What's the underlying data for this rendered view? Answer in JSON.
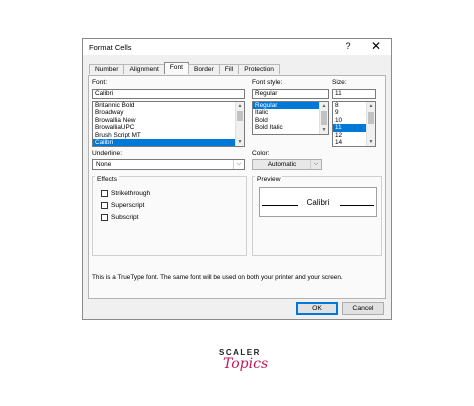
{
  "dialog": {
    "title": "Format Cells",
    "help": "?",
    "close": "✕"
  },
  "tabs": [
    {
      "label": "Number"
    },
    {
      "label": "Alignment"
    },
    {
      "label": "Font",
      "active": true
    },
    {
      "label": "Border"
    },
    {
      "label": "Fill"
    },
    {
      "label": "Protection"
    }
  ],
  "font": {
    "label": "Font:",
    "value": "Calibri",
    "items": [
      "Britannic Bold",
      "Broadway",
      "Browallia New",
      "BrowalliaUPC",
      "Brush Script MT",
      "Calibri"
    ],
    "selected": "Calibri"
  },
  "style": {
    "label": "Font style:",
    "value": "Regular",
    "items": [
      "Regular",
      "Italic",
      "Bold",
      "Bold Italic"
    ],
    "selected": "Regular"
  },
  "size": {
    "label": "Size:",
    "value": "11",
    "items": [
      "8",
      "9",
      "10",
      "11",
      "12",
      "14"
    ],
    "selected": "11"
  },
  "underline": {
    "label": "Underline:",
    "value": "None"
  },
  "color": {
    "label": "Color:",
    "value": "Automatic"
  },
  "effects": {
    "title": "Effects",
    "strikethrough": "Strikethrough",
    "superscript": "Superscript",
    "subscript": "Subscript"
  },
  "preview": {
    "title": "Preview",
    "sample": "Calibri"
  },
  "info_text": "This is a TrueType font.  The same font will be used on both your printer and your screen.",
  "buttons": {
    "ok": "OK",
    "cancel": "Cancel"
  },
  "branding": {
    "line1": "SCALER",
    "line2": "Topics"
  },
  "colors": {
    "selection": "#0078d7",
    "brand": "#c2185b"
  }
}
